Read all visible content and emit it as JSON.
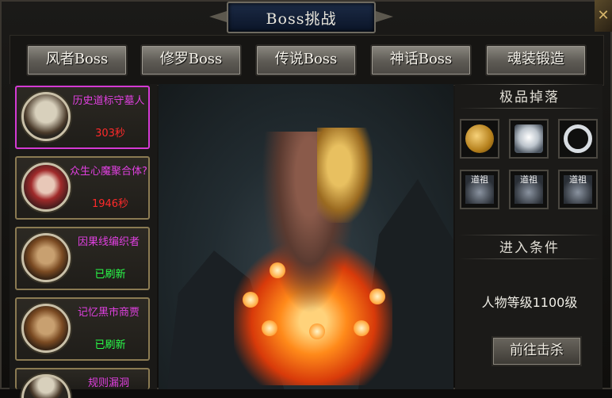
{
  "window": {
    "title": "Boss挑战",
    "close_icon": "close-icon"
  },
  "tabs": [
    {
      "label": "风者Boss"
    },
    {
      "label": "修罗Boss"
    },
    {
      "label": "传说Boss"
    },
    {
      "label": "神话Boss"
    },
    {
      "label": "魂装锻造"
    }
  ],
  "boss_list": [
    {
      "name": "历史道标守墓人",
      "status": "303秒",
      "status_color": "#ff2a2a",
      "selected": true
    },
    {
      "name": "众生心魔聚合体?",
      "status": "1946秒",
      "status_color": "#ff2a2a",
      "selected": false
    },
    {
      "name": "因果线编织者",
      "status": "已刷新",
      "status_color": "#2aff4a",
      "selected": false
    },
    {
      "name": "记忆黑市商贾",
      "status": "已刷新",
      "status_color": "#2aff4a",
      "selected": false
    },
    {
      "name": "规则漏洞",
      "status": "",
      "selected": false
    }
  ],
  "drops": {
    "title": "极品掉落",
    "items": [
      {
        "icon": "gold-coin-icon"
      },
      {
        "icon": "silver-scroll-icon"
      },
      {
        "icon": "silver-ring-icon"
      },
      {
        "icon": "daozu-item-icon",
        "label": "道祖"
      },
      {
        "icon": "daozu-item-icon",
        "label": "道祖"
      },
      {
        "icon": "daozu-item-icon",
        "label": "道祖"
      }
    ]
  },
  "entry": {
    "title": "进入条件",
    "requirement": "人物等级1100级",
    "button_label": "前往击杀"
  }
}
